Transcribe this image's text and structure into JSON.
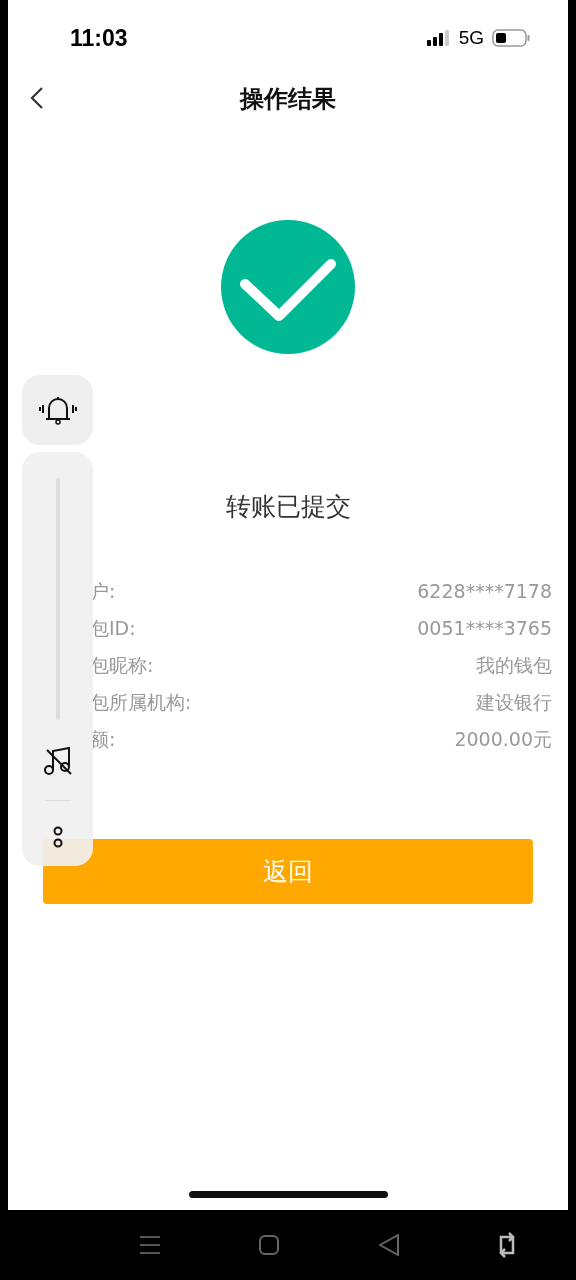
{
  "status_bar": {
    "time": "11:03",
    "network": "5G"
  },
  "nav": {
    "title": "操作结果"
  },
  "result": {
    "kind": "success",
    "message": "转账已提交"
  },
  "details": [
    {
      "label": "户:",
      "value": "6228****7178"
    },
    {
      "label": "包ID:",
      "value": "0051****3765"
    },
    {
      "label": "包昵称:",
      "value": "我的钱包"
    },
    {
      "label": "包所属机构:",
      "value": "建设银行"
    },
    {
      "label": "额:",
      "value": "2000.00元"
    }
  ],
  "button": {
    "label": "返回"
  }
}
